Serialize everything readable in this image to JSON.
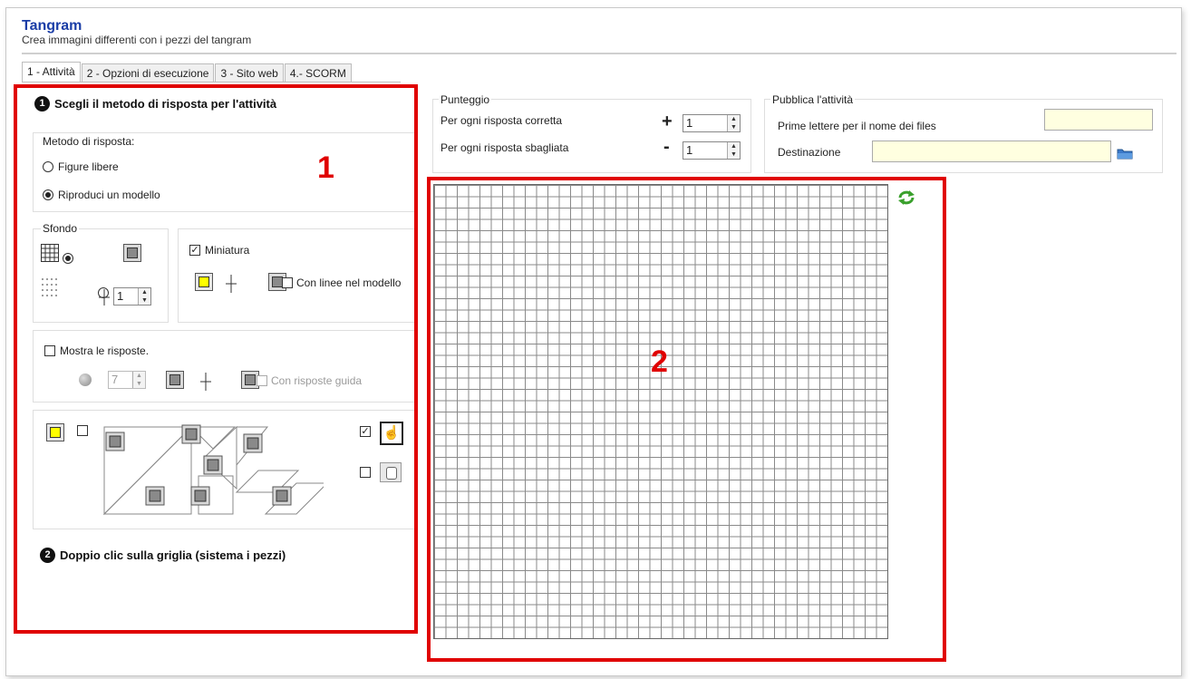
{
  "header": {
    "title": "Tangram",
    "subtitle": "Crea immagini differenti con i pezzi del tangram"
  },
  "tabs": [
    {
      "label": "1 - Attività",
      "active": true
    },
    {
      "label": "2 - Opzioni di esecuzione",
      "active": false
    },
    {
      "label": "3 - Sito web",
      "active": false
    },
    {
      "label": "4.- SCORM",
      "active": false
    }
  ],
  "step1": {
    "number": "1",
    "title": "Scegli il metodo di risposta per l'attività",
    "method_group": "Metodo di risposta:",
    "option_free": "Figure libere",
    "option_model": "Riproduci un modello",
    "selected_option": "Riproduci un modello"
  },
  "background": {
    "group_label": "Sfondo",
    "spin_value": "1"
  },
  "thumbnail": {
    "label": "Miniatura",
    "checked": true,
    "lines_label": "Con linee nel modello",
    "lines_checked": false
  },
  "answers": {
    "label": "Mostra le risposte.",
    "checked": false,
    "spin_value": "7",
    "guide_label": "Con risposte guida"
  },
  "step2": {
    "number": "2",
    "title": "Doppio clic sulla griglia (sistema i pezzi)"
  },
  "score": {
    "group_label": "Punteggio",
    "correct_label": "Per ogni risposta corretta",
    "correct_sign": "+",
    "correct_value": "1",
    "wrong_label": "Per ogni risposta sbagliata",
    "wrong_sign": "-",
    "wrong_value": "1"
  },
  "publish": {
    "group_label": "Pubblica l'attività",
    "prefix_label": "Prime lettere per il nome dei files",
    "prefix_value": "",
    "destination_label": "Destinazione",
    "destination_value": ""
  },
  "annotations": {
    "label_1": "1",
    "label_2": "2"
  },
  "colors": {
    "accent_red": "#e00000",
    "title_blue": "#1a3da6",
    "field_yellow": "#ffffe0",
    "swatch_yellow": "#ffff00"
  },
  "icons": [
    "refresh-icon",
    "folder-icon",
    "hand-pointer-icon"
  ]
}
